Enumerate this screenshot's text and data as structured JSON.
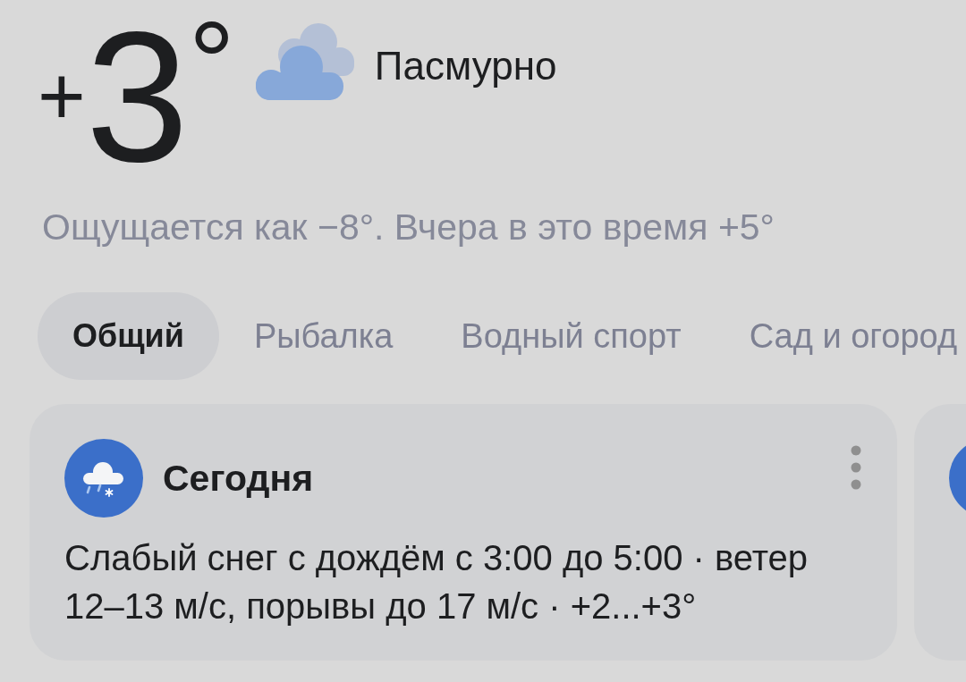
{
  "current": {
    "temperature": {
      "sign": "+",
      "value": "3",
      "unit": "°"
    },
    "condition": "Пасмурно",
    "feels_like": "Ощущается как −8°. Вчера в это время +5°"
  },
  "tabs": [
    {
      "label": "Общий",
      "selected": true
    },
    {
      "label": "Рыбалка",
      "selected": false
    },
    {
      "label": "Водный спорт",
      "selected": false
    },
    {
      "label": "Сад и огород",
      "selected": false
    }
  ],
  "cards": [
    {
      "kind": "full",
      "title": "Сегодня",
      "description": "Слабый снег с дождём с 3:00 до 5:00 · ветер 12–13 м/с, порывы до 17 м/с · +2...+3°"
    },
    {
      "kind": "partial"
    }
  ]
}
